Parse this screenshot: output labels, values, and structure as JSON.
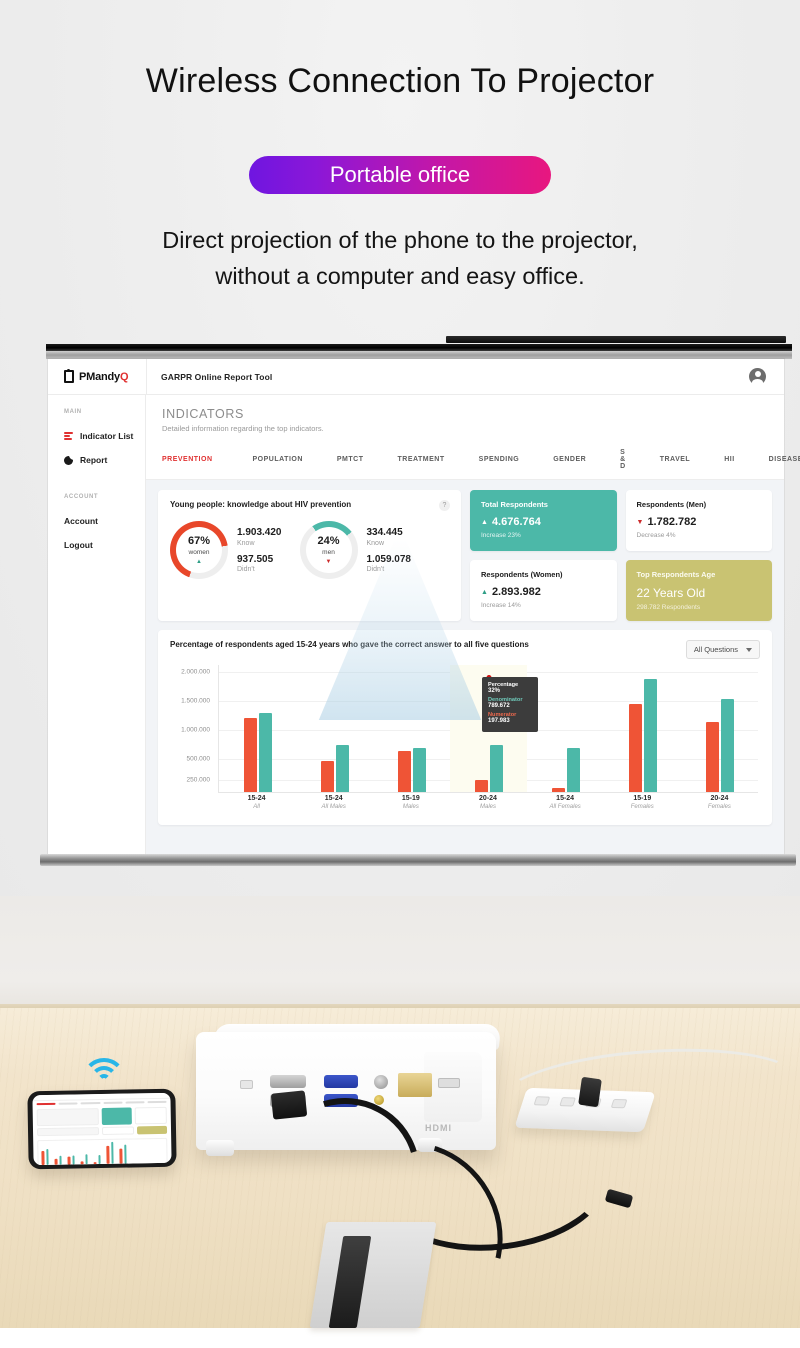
{
  "hero": {
    "title": "Wireless Connection To Projector",
    "badge": "Portable office",
    "subtitle_line1": "Direct projection of the phone to the projector,",
    "subtitle_line2": "without a computer and easy office."
  },
  "dashboard": {
    "brand": {
      "name_main": "PMandy",
      "name_accent": "Q",
      "mark_icon": "document-mark-icon"
    },
    "topbar_title": "GARPR Online Report Tool",
    "avatar_icon": "user-avatar-icon",
    "sidebar": {
      "group_main_label": "MAIN",
      "group_account_label": "ACCOUNT",
      "main_items": [
        {
          "label": "Indicator List",
          "icon": "list-icon"
        },
        {
          "label": "Report",
          "icon": "pie-chart-icon"
        }
      ],
      "account_items": [
        {
          "label": "Account"
        },
        {
          "label": "Logout"
        }
      ]
    },
    "page": {
      "title": "INDICATORS",
      "subtitle": "Detailed information regarding the top indicators."
    },
    "tabs": [
      {
        "label": "PREVENTION",
        "active": true
      },
      {
        "label": "POPULATION",
        "active": false
      },
      {
        "label": "PMTCT",
        "active": false
      },
      {
        "label": "TREATMENT",
        "active": false
      },
      {
        "label": "SPENDING",
        "active": false
      },
      {
        "label": "GENDER",
        "active": false
      },
      {
        "label": "S & D",
        "active": false
      },
      {
        "label": "TRAVEL",
        "active": false
      },
      {
        "label": "HII",
        "active": false
      },
      {
        "label": "DISEASES",
        "active": false
      }
    ],
    "knowledge_card": {
      "title": "Young people: knowledge about HIV prevention",
      "help_icon": "help-question-icon",
      "groups": [
        {
          "percent": "67%",
          "group": "women",
          "know_value": "1.903.420",
          "know_label": "Know",
          "didnt_value": "937.505",
          "didnt_label": "Didn't",
          "trend_icon": "triangle-up-icon",
          "ring_color": "#e8472a"
        },
        {
          "percent": "24%",
          "group": "men",
          "know_value": "334.445",
          "know_label": "Know",
          "didnt_value": "1.059.078",
          "didnt_label": "Didn't",
          "trend_icon": "triangle-down-icon",
          "ring_color": "#4cb8a8"
        }
      ]
    },
    "stats": [
      {
        "title": "Total Respondents",
        "value": "4.676.764",
        "note": "Increase 23%",
        "trend": "up",
        "style": "teal"
      },
      {
        "title": "Respondents (Men)",
        "value": "1.782.782",
        "note": "Decrease 4%",
        "trend": "down",
        "style": "white"
      },
      {
        "title": "Respondents (Women)",
        "value": "2.893.982",
        "note": "Increase 14%",
        "trend": "up",
        "style": "white"
      },
      {
        "title": "Top Respondents Age",
        "value": "22 Years Old",
        "note": "298.782 Respondents",
        "trend": "none",
        "style": "olive"
      }
    ],
    "chart_card": {
      "title": "Percentage of respondents aged 15-24 years who gave the correct answer to all five questions",
      "filter_label": "All Questions",
      "filter_icon": "chevron-down-icon",
      "tooltip": {
        "percentage_label": "Percentage",
        "percentage_value": "32%",
        "denominator_label": "Denominator",
        "denominator_value": "789.672",
        "numerator_label": "Numerator",
        "numerator_value": "197.983"
      }
    }
  },
  "chart_data": {
    "type": "bar",
    "title": "Percentage of respondents aged 15-24 years who gave the correct answer to all five questions",
    "xlabel": "",
    "ylabel": "",
    "ylim": [
      0,
      2150000
    ],
    "grid": true,
    "legend_position": "none",
    "ytick_labels": [
      "2.000.000",
      "1.500.000",
      "1.000.000",
      "500.000",
      "250.000"
    ],
    "ytick_values": [
      2000000,
      1500000,
      1000000,
      500000,
      250000
    ],
    "categories": [
      {
        "age": "15-24",
        "group": "All"
      },
      {
        "age": "15-24",
        "group": "All Males"
      },
      {
        "age": "15-19",
        "group": "Males"
      },
      {
        "age": "20-24",
        "group": "Males"
      },
      {
        "age": "15-24",
        "group": "All Females"
      },
      {
        "age": "15-19",
        "group": "Females"
      },
      {
        "age": "20-24",
        "group": "Females"
      }
    ],
    "series": [
      {
        "name": "Numerator",
        "color": "#ef5436",
        "values": [
          1240000,
          520000,
          690000,
          197983,
          60000,
          1480000,
          1180000
        ]
      },
      {
        "name": "Denominator",
        "color": "#4cb8a8",
        "values": [
          1320000,
          790000,
          740000,
          789672,
          730000,
          1900000,
          1560000
        ]
      }
    ],
    "highlighted_category_index": 3,
    "highlight_marker": {
      "color": "#d31212",
      "at_category": 3
    }
  },
  "photo": {
    "wifi_icon": "wifi-signal-icon",
    "hdmi_label": "HDMI",
    "device_icons": [
      "projector-icon",
      "smartphone-icon",
      "power-strip-icon",
      "cable-tray-icon"
    ]
  }
}
